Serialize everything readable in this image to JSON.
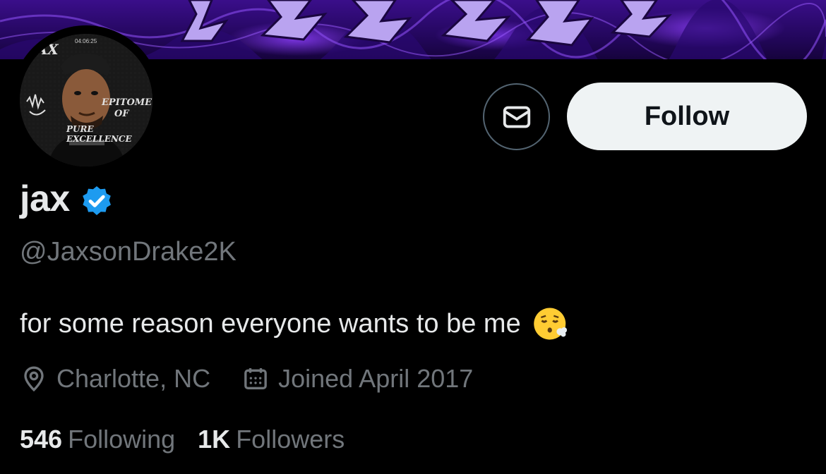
{
  "profile": {
    "display_name": "jax",
    "handle": "@JaxsonDrake2K",
    "bio": "for some reason everyone wants to be me",
    "bio_emoji": "face-exhaling-emoji",
    "location": "Charlotte, NC",
    "joined": "Joined April 2017",
    "verified": true
  },
  "actions": {
    "follow_label": "Follow",
    "message_icon": "envelope-icon"
  },
  "stats": {
    "following_count": "546",
    "following_label": "Following",
    "followers_count": "1K",
    "followers_label": "Followers"
  },
  "avatar": {
    "timestamp": "04:06:25",
    "tag": "JAX",
    "caption_line1": "EPITOME",
    "caption_line2": "OF",
    "caption_line3": "PURE EXCELLENCE"
  },
  "colors": {
    "background": "#000000",
    "text_primary": "#e7e9ea",
    "text_secondary": "#71767b",
    "verified_blue": "#1d9bf0",
    "follow_bg": "#eff3f4",
    "banner_purple": "#6a2bd0"
  }
}
